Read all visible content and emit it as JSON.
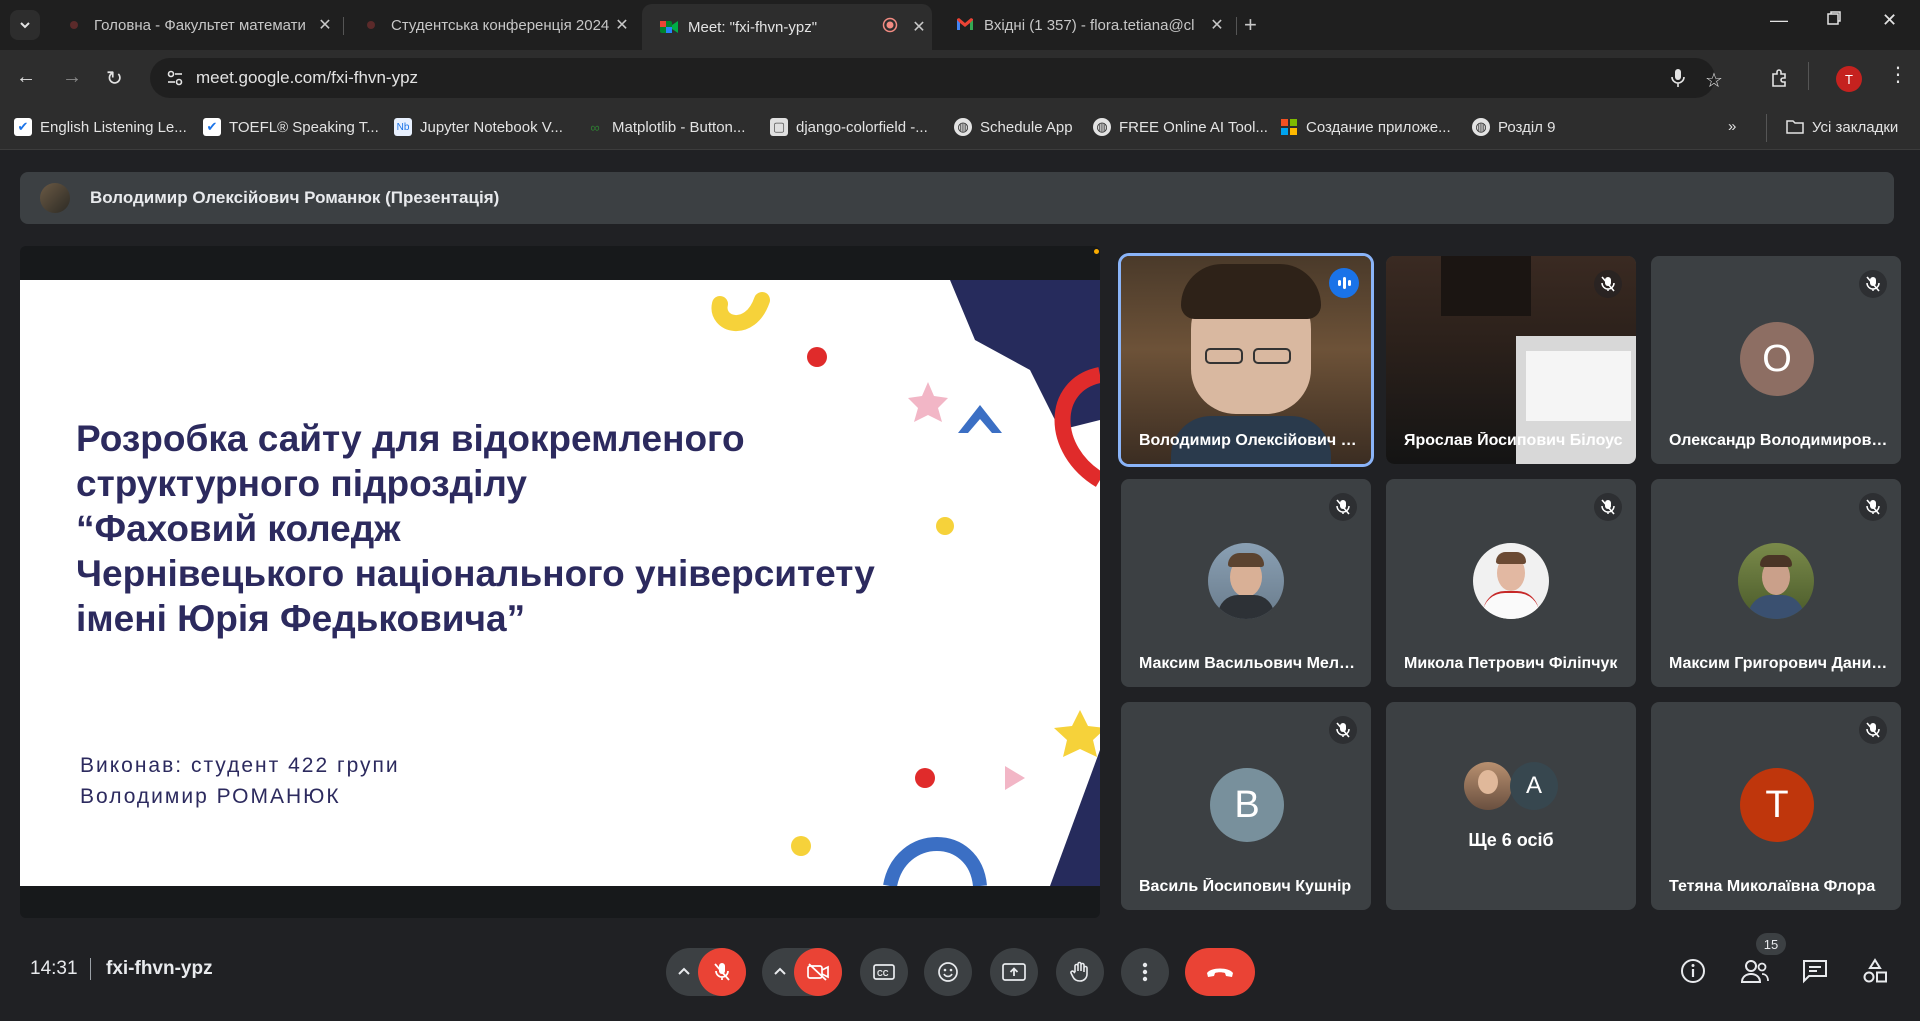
{
  "browser": {
    "tabs": [
      {
        "title": "Головна - Факультет математи",
        "icon": "recording-dot-icon"
      },
      {
        "title": "Студентська конференція 2024",
        "icon": "recording-dot-icon"
      },
      {
        "title": "Meet: \"fxi-fhvn-ypz\"",
        "icon": "google-meet-icon"
      },
      {
        "title": "Вхідні (1 357) - flora.tetiana@cl",
        "icon": "gmail-icon"
      }
    ],
    "url": "meet.google.com/fxi-fhvn-ypz",
    "profile_initial": "T",
    "bookmarks": [
      {
        "label": "English Listening Le...",
        "icon": "checkbox-icon"
      },
      {
        "label": "TOEFL® Speaking T...",
        "icon": "checkbox-icon"
      },
      {
        "label": "Jupyter Notebook V...",
        "icon": "notebook-icon"
      },
      {
        "label": "Matplotlib - Button...",
        "icon": "matplotlib-icon"
      },
      {
        "label": "django-colorfield -...",
        "icon": "package-icon"
      },
      {
        "label": "Schedule App",
        "icon": "globe-icon"
      },
      {
        "label": "FREE Online AI Tool...",
        "icon": "globe-icon"
      },
      {
        "label": "Создание приложе...",
        "icon": "microsoft-icon"
      },
      {
        "label": "Розділ 9",
        "icon": "globe-icon"
      }
    ],
    "all_bookmarks": "Усі закладки"
  },
  "meet": {
    "presenter_banner": "Володимир Олексійович Романюк (Презентація)",
    "slide": {
      "title_lines": [
        "Розробка сайту для відокремленого",
        "структурного підрозділу",
        "“Фаховий коледж",
        "Чернівецького національного університету",
        "імені Юрія Федьковича”"
      ],
      "author_lines": [
        "Виконав: студент 422 групи",
        "Володимир РОМАНЮК"
      ]
    },
    "participants": [
      {
        "name": "Володимир Олексійович Романюк",
        "kind": "video",
        "speaking": true
      },
      {
        "name": "Ярослав Йосипович Білоус",
        "kind": "video",
        "muted": true
      },
      {
        "name": "Олександр Володимирович",
        "kind": "letter",
        "letter": "О",
        "color": "#8d6e63",
        "muted": true
      },
      {
        "name": "Максим Васильович Мельник",
        "kind": "photo",
        "muted": true
      },
      {
        "name": "Микола Петрович Філіпчук",
        "kind": "photo",
        "muted": true
      },
      {
        "name": "Максим Григорович Данилюк",
        "kind": "photo",
        "muted": true
      },
      {
        "name": "Василь Йосипович Кушнір",
        "kind": "letter",
        "letter": "В",
        "color": "#78909c",
        "muted": true
      },
      {
        "name": "",
        "kind": "more",
        "text": "Ще 6 осіб",
        "letter": "А"
      },
      {
        "name": "Тетяна Миколаївна Флора",
        "kind": "letter",
        "letter": "Т",
        "color": "#bf360c",
        "muted": true
      }
    ],
    "time": "14:31",
    "meeting_code": "fxi-fhvn-ypz",
    "participant_count": "15"
  }
}
